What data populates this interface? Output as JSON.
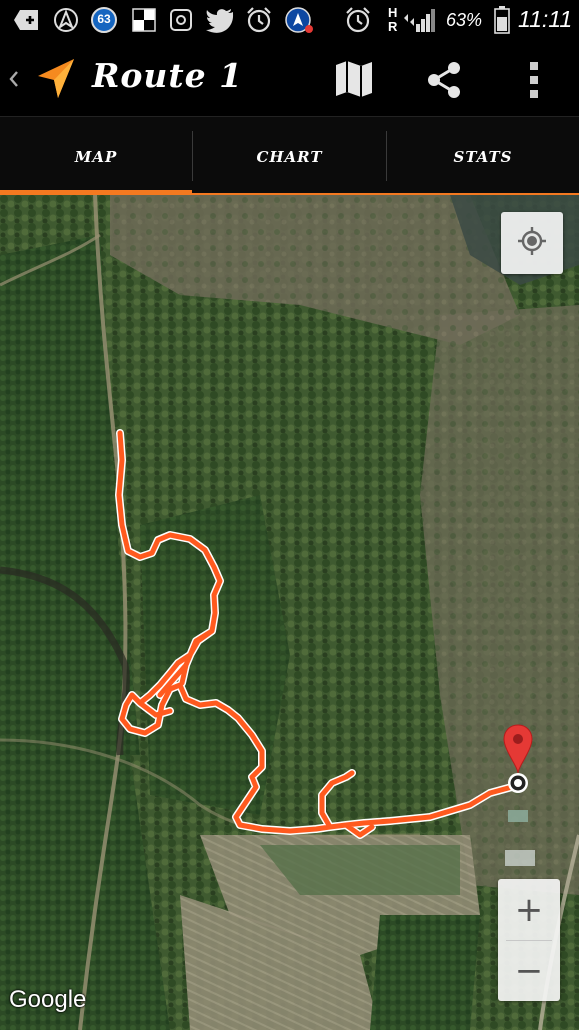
{
  "status_bar": {
    "notification_count": "63",
    "network_label_h": "H",
    "network_label_r": "R",
    "battery": "63%",
    "time": "11:11",
    "icons": [
      "add-icon",
      "navigation-app-icon",
      "notification-count-icon",
      "chess-icon",
      "screenshot-icon",
      "twitter-icon",
      "alarm-icon",
      "app-alert-icon",
      "alarm-icon",
      "signal-icon",
      "battery-icon"
    ]
  },
  "app_bar": {
    "back_icon": "chevron-left-icon",
    "logo_icon": "navigation-arrow-icon",
    "title": "Route 1",
    "actions": [
      "map-icon",
      "share-icon",
      "overflow-menu-icon"
    ]
  },
  "tabs": [
    {
      "label": "MAP",
      "active": true
    },
    {
      "label": "CHART",
      "active": false
    },
    {
      "label": "STATS",
      "active": false
    }
  ],
  "map": {
    "attribution": "Google",
    "controls": {
      "locate": "my-location-icon",
      "zoom_in": "+",
      "zoom_out": "−"
    },
    "end_marker": "map-pin-icon"
  },
  "colors": {
    "accent": "#f47920",
    "route": "#ff5a1f",
    "route_outline": "#ffffff",
    "pin": "#e53935"
  }
}
